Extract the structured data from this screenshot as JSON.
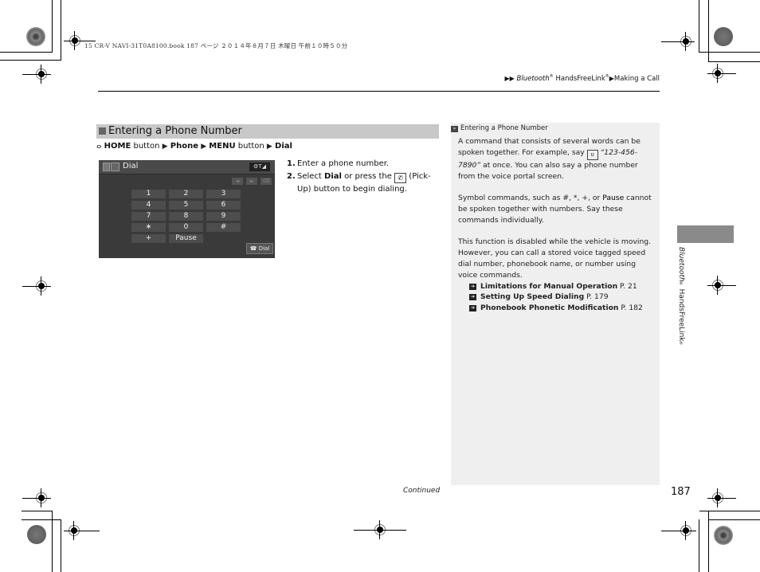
{
  "file_header": "15 CR-V NAVI-31T0A8100.book  187 ページ  ２０１４年８月７日  木曜日  午前１０時５０分",
  "breadcrumb": {
    "arrows": "▶▶",
    "part1": "Bluetooth",
    "reg1": "®",
    "part2": " HandsFreeLink",
    "reg2": "®",
    "sep": "▶",
    "part3": "Making a Call"
  },
  "section": {
    "title": "Entering a Phone Number"
  },
  "nav_path": {
    "icon": "home-button-icon",
    "items": [
      {
        "bold": "HOME",
        "plain": " button "
      },
      {
        "bold": "Phone",
        "plain": " "
      },
      {
        "bold": "MENU",
        "plain": " button "
      },
      {
        "bold": "Dial",
        "plain": ""
      }
    ],
    "separator": "▶"
  },
  "screen": {
    "title": "Dial",
    "status": "⚙T◢",
    "arrow_buttons": [
      "◄",
      "►",
      "⌫"
    ],
    "keys": [
      [
        "1",
        "2",
        "3"
      ],
      [
        "4",
        "5",
        "6"
      ],
      [
        "7",
        "8",
        "9"
      ],
      [
        "∗",
        "0",
        "#"
      ],
      [
        "+",
        "Pause",
        ""
      ]
    ],
    "dial_button": "Dial",
    "dial_icon": "pickup-phone-icon"
  },
  "steps": [
    {
      "num": "1.",
      "text": "Enter a phone number."
    },
    {
      "num": "2.",
      "pre": "Select ",
      "bold": "Dial",
      "mid": " or press the ",
      "post": " (Pick-Up) button to begin dialing."
    }
  ],
  "note": {
    "heading": "Entering a Phone Number",
    "p1_pre": "A command that consists of several words can be spoken together. For example, say ",
    "p1_quote": "“123-456-7890”",
    "p1_post": " at once. You can also say a phone number from the voice portal screen.",
    "p2_pre": "Symbol commands, such as #, *, +, or ",
    "p2_bold": "Pause",
    "p2_post": " cannot be spoken together with numbers. Say these commands individually.",
    "p3": "This function is disabled while the vehicle is moving. However, you can call a stored voice tagged speed dial number, phonebook name, or number using voice commands.",
    "xrefs": [
      {
        "title": "Limitations for Manual Operation",
        "page": " P. 21"
      },
      {
        "title": "Setting Up Speed Dialing",
        "page": " P. 179"
      },
      {
        "title": "Phonebook Phonetic Modification",
        "page": " P. 182"
      }
    ]
  },
  "side_label": {
    "part1": "Bluetooth",
    "reg1": "®",
    "part2": " HandsFreeLink",
    "reg2": "®"
  },
  "footer": {
    "continued": "Continued",
    "page_number": "187"
  }
}
